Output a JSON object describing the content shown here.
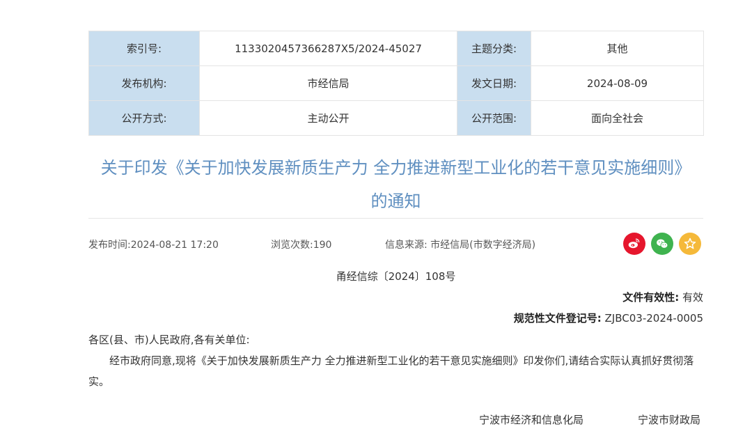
{
  "meta": {
    "index_label": "索引号:",
    "index_value": "1133020457366287X5/2024-45027",
    "topic_label": "主题分类:",
    "topic_value": "其他",
    "publisher_label": "发布机构:",
    "publisher_value": "市经信局",
    "issue_date_label": "发文日期:",
    "issue_date_value": "2024-08-09",
    "disclosure_label": "公开方式:",
    "disclosure_value": "主动公开",
    "scope_label": "公开范围:",
    "scope_value": "面向全社会"
  },
  "title": {
    "line1": "关于印发《关于加快发展新质生产力 全力推进新型工业化的若干意见实施细则》",
    "line2": "的通知"
  },
  "info": {
    "publish_time": "发布时间:2024-08-21 17:20",
    "views": "浏览次数:190",
    "source": "信息来源: 市经信局(市数字经济局)"
  },
  "share": {
    "weibo_icon": "weibo-icon",
    "wechat_icon": "wechat-icon",
    "favorite_icon": "star-icon",
    "weibo_color": "#e6162d",
    "wechat_color": "#3fb34f",
    "favorite_color": "#f5b93a"
  },
  "doc": {
    "number": "甬经信综〔2024〕108号",
    "validity_label": "文件有效性:",
    "validity_value": "有效",
    "reg_label": "规范性文件登记号:",
    "reg_value": "ZJBC03-2024-0005",
    "salutation": "各区(县、市)人民政府,各有关单位:",
    "paragraph": "经市政府同意,现将《关于加快发展新质生产力 全力推进新型工业化的若干意见实施细则》印发你们,请结合实际认真抓好贯彻落实。",
    "signer1": "宁波市经济和信息化局",
    "signer2": "宁波市财政局"
  },
  "colors": {
    "label_bg": "#c9deef",
    "title": "#5f8fc0"
  }
}
